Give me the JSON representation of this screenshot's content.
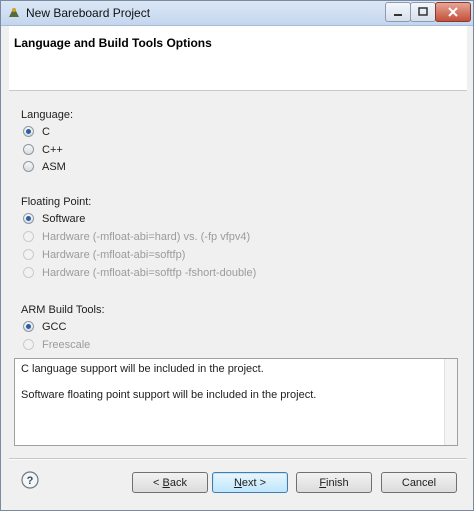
{
  "window": {
    "title": "New Bareboard Project"
  },
  "header": {
    "title": "Language and Build Tools Options"
  },
  "language": {
    "label": "Language:",
    "options": [
      {
        "label": "C",
        "checked": true,
        "enabled": true
      },
      {
        "label": "C++",
        "checked": false,
        "enabled": true
      },
      {
        "label": "ASM",
        "checked": false,
        "enabled": true
      }
    ]
  },
  "floating_point": {
    "label": "Floating Point:",
    "options": [
      {
        "label": "Software",
        "checked": true,
        "enabled": true
      },
      {
        "label": "Hardware (-mfloat-abi=hard) vs. (-fp vfpv4)",
        "checked": false,
        "enabled": false
      },
      {
        "label": "Hardware (-mfloat-abi=softfp)",
        "checked": false,
        "enabled": false
      },
      {
        "label": "Hardware (-mfloat-abi=softfp -fshort-double)",
        "checked": false,
        "enabled": false
      }
    ]
  },
  "arm_build_tools": {
    "label": "ARM Build Tools:",
    "options": [
      {
        "label": "GCC",
        "checked": true,
        "enabled": true
      },
      {
        "label": "Freescale",
        "checked": false,
        "enabled": false
      }
    ]
  },
  "description": {
    "lines": [
      "C language support will be included in the project.",
      "Software floating point support will be included in the project."
    ]
  },
  "buttons": {
    "back": {
      "prefix": "< ",
      "mnemonic": "B",
      "rest": "ack"
    },
    "next": {
      "mnemonic": "N",
      "rest": "ext >"
    },
    "finish": {
      "mnemonic": "F",
      "rest": "inish"
    },
    "cancel": "Cancel"
  },
  "colors": {
    "accent": "#3c7fb1",
    "titlebar": "#c4d6ee",
    "close": "#c3503a"
  }
}
